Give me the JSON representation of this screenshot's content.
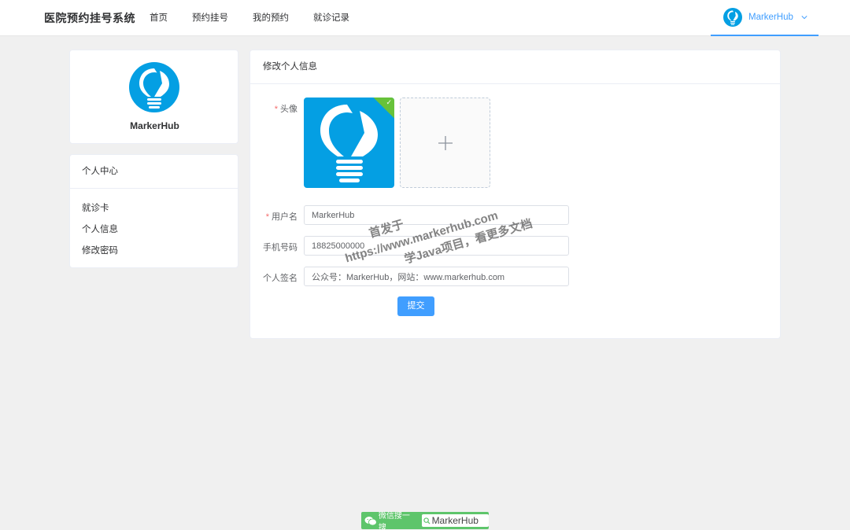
{
  "header": {
    "brand": "医院预约挂号系统",
    "nav": [
      "首页",
      "预约挂号",
      "我的预约",
      "就诊记录"
    ],
    "user_name": "MarkerHub"
  },
  "profile": {
    "name": "MarkerHub"
  },
  "menu": {
    "title": "个人中心",
    "items": [
      "就诊卡",
      "个人信息",
      "修改密码"
    ]
  },
  "form": {
    "title": "修改个人信息",
    "avatar_label": "头像",
    "username_label": "用户名",
    "username_value": "MarkerHub",
    "phone_label": "手机号码",
    "phone_value": "18825000000",
    "signature_label": "个人签名",
    "signature_value": "公众号：MarkerHub，网站：www.markerhub.com",
    "submit_label": "提交"
  },
  "watermark": {
    "line1": "首发于",
    "line2": "https://www.markerhub.com",
    "line3": "学Java项目，看更多文档"
  },
  "badge": {
    "text": "微信搜一搜",
    "search": "MarkerHub"
  },
  "colors": {
    "accent": "#409eff",
    "logo_blue": "#049fe3",
    "success": "#67c23a",
    "required": "#f56c6c"
  }
}
